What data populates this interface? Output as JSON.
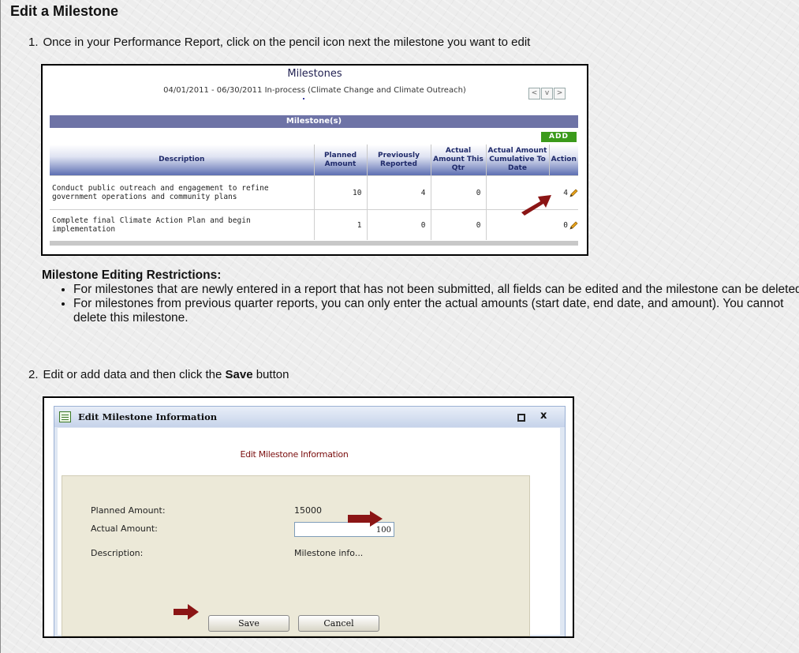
{
  "heading": "Edit a Milestone",
  "step1": {
    "number": "1.",
    "text": "Once in your Performance Report, click on the pencil icon next the milestone you want to edit"
  },
  "milestones_shot": {
    "title": "Milestones",
    "subtitle": "04/01/2011 - 06/30/2011 In-process (Climate Change and Climate Outreach)",
    "nav_buttons": [
      "<",
      "v",
      ">"
    ],
    "section_label": "Milestone(s)",
    "add_label": "ADD",
    "columns": [
      "Description",
      "Planned Amount",
      "Previously Reported",
      "Actual Amount This Qtr",
      "Actual Amount Cumulative To Date",
      "Action"
    ],
    "rows": [
      {
        "description": "Conduct public outreach and engagement to refine government operations and community plans",
        "planned": "10",
        "previously": "4",
        "this_qtr": "0",
        "cumulative": "4"
      },
      {
        "description": "Complete final Climate Action Plan and begin implementation",
        "planned": "1",
        "previously": "0",
        "this_qtr": "0",
        "cumulative": "0"
      }
    ]
  },
  "restrictions": {
    "title": "Milestone Editing Restrictions:",
    "items": [
      "For milestones that are newly entered in a report that has not been submitted, all fields can be edited and the milestone can be deleted",
      "For milestones from previous quarter reports, you can only enter the actual amounts (start date, end date, and amount). You cannot delete this milestone."
    ]
  },
  "step2": {
    "number": "2.",
    "text_before": "Edit or add data and then click the ",
    "bold": "Save",
    "text_after": " button"
  },
  "edit_shot": {
    "window_title": "Edit Milestone Information",
    "close_glyph": "x",
    "heading": "Edit Milestone Information",
    "planned_label": "Planned Amount:",
    "planned_value": "15000",
    "actual_label": "Actual Amount:",
    "actual_value": "100",
    "description_label": "Description:",
    "description_value": "Milestone info...",
    "save_label": "Save",
    "cancel_label": "Cancel"
  },
  "colors": {
    "arrow": "#8b1515",
    "header_bar": "#6e73a6",
    "add_button": "#3b9a1b",
    "dialog_heading": "#7a0e0e"
  }
}
